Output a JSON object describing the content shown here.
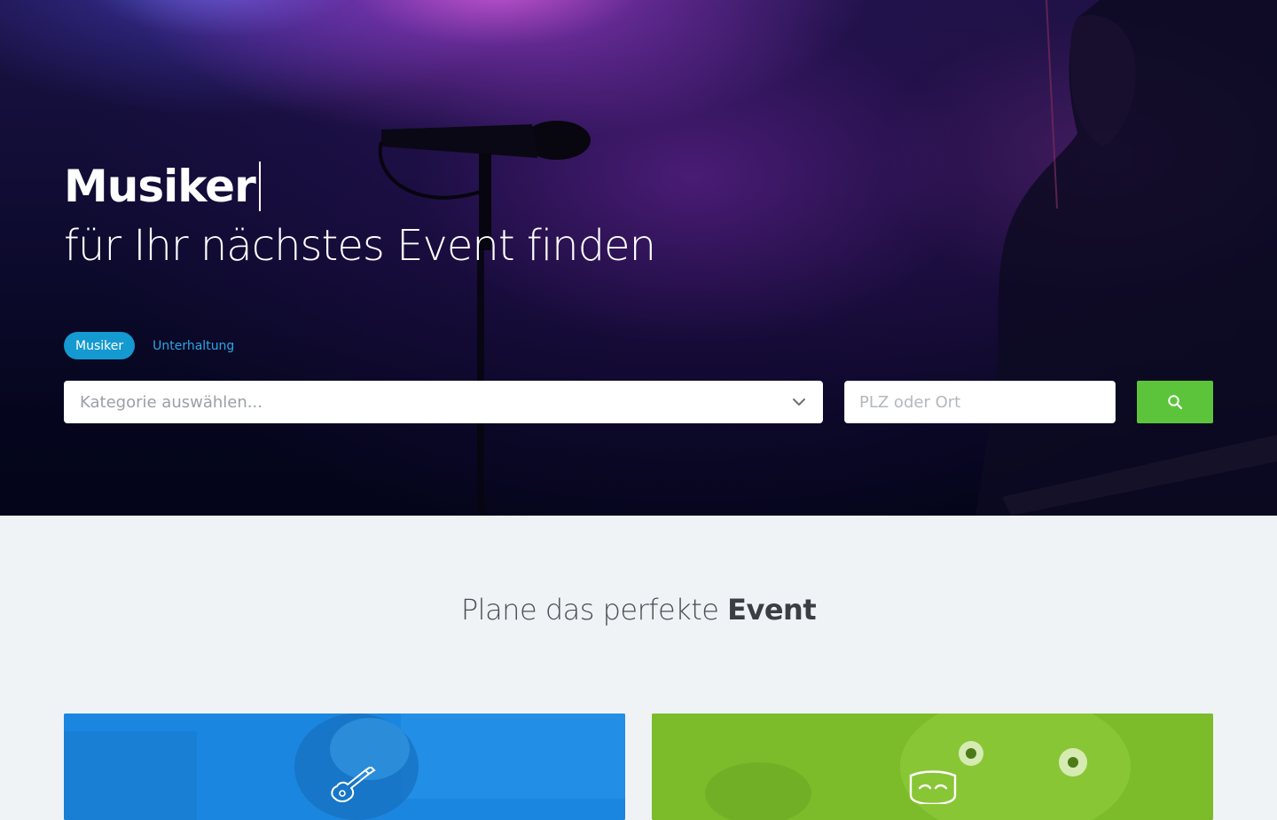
{
  "hero": {
    "headline_bold": "Musiker",
    "headline_rest": "für Ihr nächstes Event finden"
  },
  "tabs": {
    "active": "Musiker",
    "other": "Unterhaltung"
  },
  "search": {
    "category_placeholder": "Kategorie auswählen...",
    "location_placeholder": "PLZ oder Ort"
  },
  "icons": {
    "dropdown": "chevron-down-icon",
    "search": "search-icon",
    "card_music": "guitar-icon",
    "card_entertainment": "mask-icon"
  },
  "section": {
    "title_prefix": "Plane das perfekte",
    "title_bold": "Event"
  },
  "colors": {
    "tab_active": "#1499d0",
    "search_button": "#5cc43a",
    "card_music": "#1b86e0",
    "card_entertainment": "#7cbc2a",
    "page_background": "#eff3f6"
  }
}
